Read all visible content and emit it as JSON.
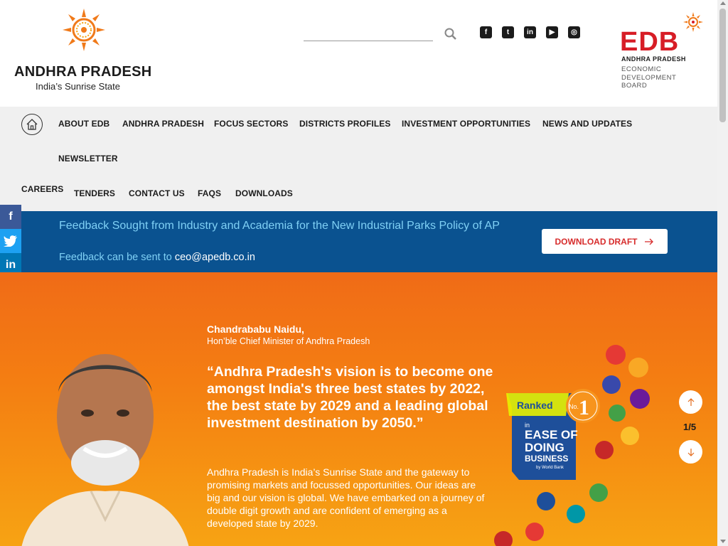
{
  "header": {
    "site_title": "ANDHRA PRADESH",
    "tagline": "India’s Sunrise State",
    "search_placeholder": "",
    "social": [
      "facebook-icon",
      "twitter-icon",
      "linkedin-icon",
      "youtube-icon",
      "instagram-icon"
    ],
    "edb": {
      "name": "EDB",
      "state": "ANDHRA PRADESH",
      "subtitle": "ECONOMIC\nDEVELOPMENT\nBOARD"
    }
  },
  "nav": {
    "items": [
      "ABOUT EDB",
      "ANDHRA PRADESH",
      "FOCUS SECTORS",
      "DISTRICTS PROFILES",
      "INVESTMENT OPPORTUNITIES",
      "NEWS AND UPDATES",
      "NEWSLETTER",
      "CAREERS",
      "TENDERS",
      "CONTACT US",
      "FAQS",
      "DOWNLOADS"
    ]
  },
  "banner": {
    "title": "Feedback Sought from Industry and Academia for the New Industrial Parks Policy of AP",
    "feedback_text": "Feedback can be sent to",
    "email": "ceo@apedb.co.in",
    "button": "DOWNLOAD DRAFT"
  },
  "hero": {
    "author": "Chandrababu Naidu,",
    "role": "Hon’ble Chief Minister of Andhra Pradesh",
    "quote": "“Andhra Pradesh's vision is to become one amongst India's three best states by 2022, the best state by 2029 and a leading global investment destination by 2050.”",
    "body": "Andhra Pradesh is India’s Sunrise State and the gateway to promising markets and focussed opportunities. Our ideas are big and our vision is global. We have embarked on a journey of double digit growth and are confident of emerging as a developed state by 2029.",
    "slide_counter": "1/5",
    "badge": {
      "ranked": "Ranked",
      "no": "No.",
      "rank": "1",
      "in": "in",
      "line1": "EASE OF",
      "line2": "DOING",
      "line3": "BUSINESS",
      "by": "by World Bank"
    }
  },
  "colors": {
    "banner_bg": "#0a5290",
    "banner_text": "#7fd0f5",
    "hero_top": "#f06b17",
    "hero_bottom": "#f7a313",
    "edb_red": "#d71d26"
  }
}
